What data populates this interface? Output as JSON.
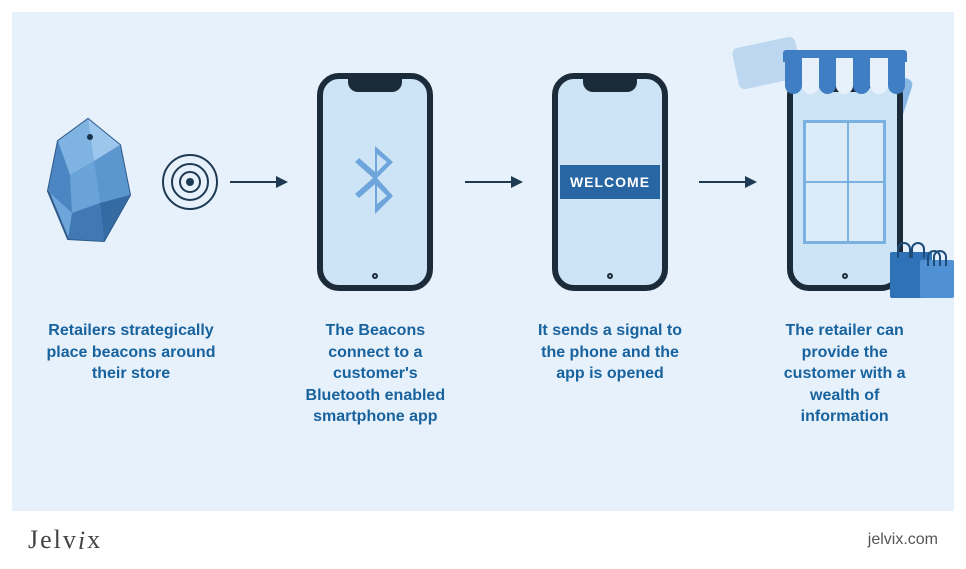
{
  "steps": [
    {
      "caption": "Retailers strategically place beacons around their store"
    },
    {
      "caption": "The Beacons connect to a customer's Bluetooth enabled smartphone app"
    },
    {
      "caption": "It sends a signal to the phone and the app is opened",
      "welcome_label": "WELCOME"
    },
    {
      "caption": "The retailer can provide the customer with a wealth of information"
    }
  ],
  "footer": {
    "brand": "Jelvix",
    "url": "jelvix.com"
  },
  "colors": {
    "panel_bg": "#e6f1fb",
    "caption": "#18629e",
    "phone_frame": "#1c2b3a",
    "accent": "#2865a3"
  }
}
